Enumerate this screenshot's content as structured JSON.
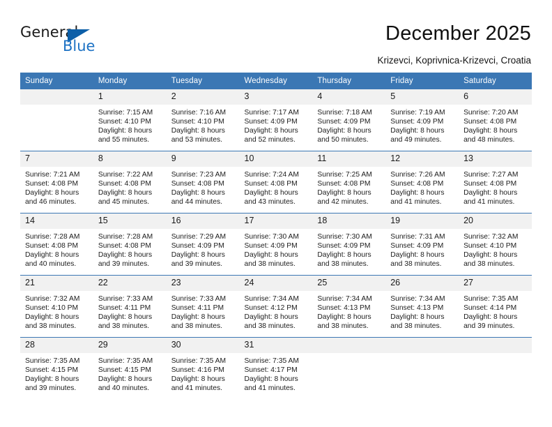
{
  "brand": {
    "word_one": "General",
    "word_two": "Blue",
    "accent_color": "#1d72c4",
    "triangle_color": "#0d5fa8"
  },
  "header": {
    "title": "December 2025",
    "subtitle": "Krizevci, Koprivnica-Krizevci, Croatia"
  },
  "calendar": {
    "header_bg": "#3b77b4",
    "daynum_bg": "#f1f1f1",
    "weekdays": [
      "Sunday",
      "Monday",
      "Tuesday",
      "Wednesday",
      "Thursday",
      "Friday",
      "Saturday"
    ],
    "weeks": [
      [
        {
          "day": "",
          "lines": []
        },
        {
          "day": "1",
          "lines": [
            "Sunrise: 7:15 AM",
            "Sunset: 4:10 PM",
            "Daylight: 8 hours",
            "and 55 minutes."
          ]
        },
        {
          "day": "2",
          "lines": [
            "Sunrise: 7:16 AM",
            "Sunset: 4:10 PM",
            "Daylight: 8 hours",
            "and 53 minutes."
          ]
        },
        {
          "day": "3",
          "lines": [
            "Sunrise: 7:17 AM",
            "Sunset: 4:09 PM",
            "Daylight: 8 hours",
            "and 52 minutes."
          ]
        },
        {
          "day": "4",
          "lines": [
            "Sunrise: 7:18 AM",
            "Sunset: 4:09 PM",
            "Daylight: 8 hours",
            "and 50 minutes."
          ]
        },
        {
          "day": "5",
          "lines": [
            "Sunrise: 7:19 AM",
            "Sunset: 4:09 PM",
            "Daylight: 8 hours",
            "and 49 minutes."
          ]
        },
        {
          "day": "6",
          "lines": [
            "Sunrise: 7:20 AM",
            "Sunset: 4:08 PM",
            "Daylight: 8 hours",
            "and 48 minutes."
          ]
        }
      ],
      [
        {
          "day": "7",
          "lines": [
            "Sunrise: 7:21 AM",
            "Sunset: 4:08 PM",
            "Daylight: 8 hours",
            "and 46 minutes."
          ]
        },
        {
          "day": "8",
          "lines": [
            "Sunrise: 7:22 AM",
            "Sunset: 4:08 PM",
            "Daylight: 8 hours",
            "and 45 minutes."
          ]
        },
        {
          "day": "9",
          "lines": [
            "Sunrise: 7:23 AM",
            "Sunset: 4:08 PM",
            "Daylight: 8 hours",
            "and 44 minutes."
          ]
        },
        {
          "day": "10",
          "lines": [
            "Sunrise: 7:24 AM",
            "Sunset: 4:08 PM",
            "Daylight: 8 hours",
            "and 43 minutes."
          ]
        },
        {
          "day": "11",
          "lines": [
            "Sunrise: 7:25 AM",
            "Sunset: 4:08 PM",
            "Daylight: 8 hours",
            "and 42 minutes."
          ]
        },
        {
          "day": "12",
          "lines": [
            "Sunrise: 7:26 AM",
            "Sunset: 4:08 PM",
            "Daylight: 8 hours",
            "and 41 minutes."
          ]
        },
        {
          "day": "13",
          "lines": [
            "Sunrise: 7:27 AM",
            "Sunset: 4:08 PM",
            "Daylight: 8 hours",
            "and 41 minutes."
          ]
        }
      ],
      [
        {
          "day": "14",
          "lines": [
            "Sunrise: 7:28 AM",
            "Sunset: 4:08 PM",
            "Daylight: 8 hours",
            "and 40 minutes."
          ]
        },
        {
          "day": "15",
          "lines": [
            "Sunrise: 7:28 AM",
            "Sunset: 4:08 PM",
            "Daylight: 8 hours",
            "and 39 minutes."
          ]
        },
        {
          "day": "16",
          "lines": [
            "Sunrise: 7:29 AM",
            "Sunset: 4:09 PM",
            "Daylight: 8 hours",
            "and 39 minutes."
          ]
        },
        {
          "day": "17",
          "lines": [
            "Sunrise: 7:30 AM",
            "Sunset: 4:09 PM",
            "Daylight: 8 hours",
            "and 38 minutes."
          ]
        },
        {
          "day": "18",
          "lines": [
            "Sunrise: 7:30 AM",
            "Sunset: 4:09 PM",
            "Daylight: 8 hours",
            "and 38 minutes."
          ]
        },
        {
          "day": "19",
          "lines": [
            "Sunrise: 7:31 AM",
            "Sunset: 4:09 PM",
            "Daylight: 8 hours",
            "and 38 minutes."
          ]
        },
        {
          "day": "20",
          "lines": [
            "Sunrise: 7:32 AM",
            "Sunset: 4:10 PM",
            "Daylight: 8 hours",
            "and 38 minutes."
          ]
        }
      ],
      [
        {
          "day": "21",
          "lines": [
            "Sunrise: 7:32 AM",
            "Sunset: 4:10 PM",
            "Daylight: 8 hours",
            "and 38 minutes."
          ]
        },
        {
          "day": "22",
          "lines": [
            "Sunrise: 7:33 AM",
            "Sunset: 4:11 PM",
            "Daylight: 8 hours",
            "and 38 minutes."
          ]
        },
        {
          "day": "23",
          "lines": [
            "Sunrise: 7:33 AM",
            "Sunset: 4:11 PM",
            "Daylight: 8 hours",
            "and 38 minutes."
          ]
        },
        {
          "day": "24",
          "lines": [
            "Sunrise: 7:34 AM",
            "Sunset: 4:12 PM",
            "Daylight: 8 hours",
            "and 38 minutes."
          ]
        },
        {
          "day": "25",
          "lines": [
            "Sunrise: 7:34 AM",
            "Sunset: 4:13 PM",
            "Daylight: 8 hours",
            "and 38 minutes."
          ]
        },
        {
          "day": "26",
          "lines": [
            "Sunrise: 7:34 AM",
            "Sunset: 4:13 PM",
            "Daylight: 8 hours",
            "and 38 minutes."
          ]
        },
        {
          "day": "27",
          "lines": [
            "Sunrise: 7:35 AM",
            "Sunset: 4:14 PM",
            "Daylight: 8 hours",
            "and 39 minutes."
          ]
        }
      ],
      [
        {
          "day": "28",
          "lines": [
            "Sunrise: 7:35 AM",
            "Sunset: 4:15 PM",
            "Daylight: 8 hours",
            "and 39 minutes."
          ]
        },
        {
          "day": "29",
          "lines": [
            "Sunrise: 7:35 AM",
            "Sunset: 4:15 PM",
            "Daylight: 8 hours",
            "and 40 minutes."
          ]
        },
        {
          "day": "30",
          "lines": [
            "Sunrise: 7:35 AM",
            "Sunset: 4:16 PM",
            "Daylight: 8 hours",
            "and 41 minutes."
          ]
        },
        {
          "day": "31",
          "lines": [
            "Sunrise: 7:35 AM",
            "Sunset: 4:17 PM",
            "Daylight: 8 hours",
            "and 41 minutes."
          ]
        },
        {
          "day": "",
          "lines": []
        },
        {
          "day": "",
          "lines": []
        },
        {
          "day": "",
          "lines": []
        }
      ]
    ]
  }
}
